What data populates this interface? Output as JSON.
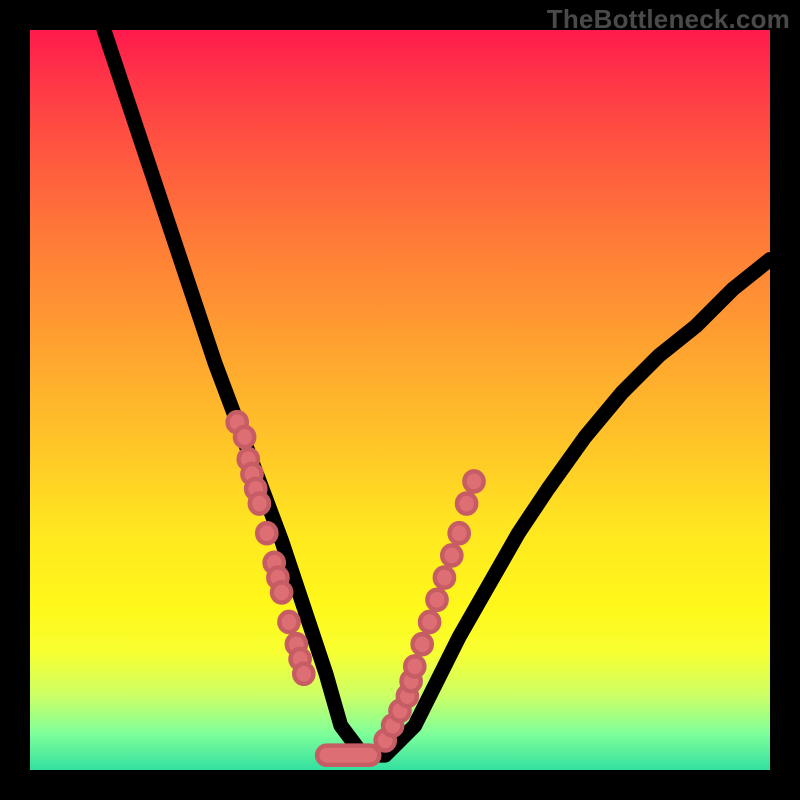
{
  "watermark": "TheBottleneck.com",
  "colors": {
    "background": "#000000",
    "marker_fill": "#dd6e74",
    "marker_stroke": "#c65c64",
    "curve": "#000000"
  },
  "chart_data": {
    "type": "line",
    "title": "",
    "xlabel": "",
    "ylabel": "",
    "xlim": [
      0,
      100
    ],
    "ylim": [
      0,
      100
    ],
    "grid": false,
    "series": [
      {
        "name": "bottleneck-curve",
        "x": [
          10,
          13,
          16,
          19,
          22,
          25,
          28,
          31,
          34,
          36,
          38,
          40,
          42,
          45,
          48,
          52,
          55,
          58,
          62,
          66,
          70,
          75,
          80,
          85,
          90,
          95,
          100
        ],
        "y": [
          100,
          91,
          82,
          73,
          64,
          55,
          47,
          39,
          31,
          25,
          19,
          13,
          6,
          2,
          2,
          6,
          12,
          18,
          25,
          32,
          38,
          45,
          51,
          56,
          60,
          65,
          69
        ]
      }
    ],
    "markers": {
      "left_cluster": [
        [
          28,
          47
        ],
        [
          29,
          45
        ],
        [
          29.5,
          42
        ],
        [
          30,
          40
        ],
        [
          30.5,
          38
        ],
        [
          31,
          36
        ],
        [
          32,
          32
        ],
        [
          33,
          28
        ],
        [
          33.5,
          26
        ],
        [
          34,
          24
        ],
        [
          35,
          20
        ],
        [
          36,
          17
        ],
        [
          36.5,
          15
        ],
        [
          37,
          13
        ]
      ],
      "right_cluster": [
        [
          48,
          4
        ],
        [
          49,
          6
        ],
        [
          50,
          8
        ],
        [
          51,
          10
        ],
        [
          51.5,
          12
        ],
        [
          52,
          14
        ],
        [
          53,
          17
        ],
        [
          54,
          20
        ],
        [
          55,
          23
        ],
        [
          56,
          26
        ],
        [
          57,
          29
        ],
        [
          58,
          32
        ],
        [
          59,
          36
        ],
        [
          60,
          39
        ]
      ],
      "floor": [
        [
          40,
          2
        ],
        [
          42,
          2
        ],
        [
          44,
          2
        ],
        [
          46,
          2
        ]
      ]
    },
    "annotations": []
  }
}
